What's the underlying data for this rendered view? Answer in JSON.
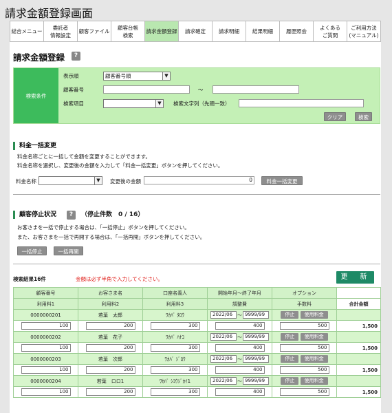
{
  "window_title": "請求金額登録画面",
  "nav": [
    {
      "label": "総合メニュー",
      "active": false
    },
    {
      "label": "委託者\n情報設定",
      "active": false
    },
    {
      "label": "顧客ファイル",
      "active": false
    },
    {
      "label": "顧客台帳\n検索",
      "active": false
    },
    {
      "label": "請求金額登録",
      "active": true
    },
    {
      "label": "請求確定",
      "active": false
    },
    {
      "label": "請求明細",
      "active": false
    },
    {
      "label": "結果明細",
      "active": false
    },
    {
      "label": "履歴照会",
      "active": false
    },
    {
      "label": "よくある\nご質問",
      "active": false
    },
    {
      "label": "ご利用方法\n(マニュアル)",
      "active": false
    }
  ],
  "page_title": "請求金額登録",
  "help_glyph": "?",
  "search": {
    "section_label": "検索条件",
    "sort_label": "表示順",
    "sort_value": "顧客番号順",
    "customer_no_label": "顧客番号",
    "range_sep": "～",
    "item_label": "検索項目",
    "text_label": "検索文字列（先頭一致）",
    "clear_button": "クリア",
    "search_button": "検索"
  },
  "bulk": {
    "title": "料金一括変更",
    "desc1": "料金名称ごとに一括して金額を変更することができます。",
    "desc2": "料金名称を選択し、変更後の金額を入力して「料金一括変更」ボタンを押してください。",
    "fee_name_label": "料金名称",
    "new_amount_label": "変更後の金額",
    "new_amount_value": "0",
    "bulk_button": "料金一括変更"
  },
  "stop": {
    "title": "顧客停止状況",
    "count_text": "（停止件数　0 / 16）",
    "desc1": "お客さまを一括で停止する場合は、「一括停止」ボタンを押してください。",
    "desc2": "また、お客さまを一括で再開する場合は、「一括再開」ボタンを押してください。",
    "stop_all_button": "一括停止",
    "resume_all_button": "一括再開"
  },
  "results": {
    "count_label": "検索結果16件",
    "notice": "金額は必ず半角で入力してください。",
    "update_button": "更　新",
    "header_top": [
      "顧客番号",
      "お客さま名",
      "口座名義人",
      "開始年月～終了年月",
      "オプション"
    ],
    "header_bottom": [
      "利用料1",
      "利用料2",
      "利用料3",
      "調整費",
      "手数料",
      "合計金額"
    ],
    "rows": [
      {
        "customer_no": "0000000201",
        "name": "若葉　太郎",
        "holder": "ﾜｶﾊﾞ ﾀﾛｳ",
        "start": "2022/06",
        "end": "9999/99",
        "stop": "停止",
        "fee_button": "使用料金",
        "f1": "100",
        "f2": "200",
        "f3": "300",
        "adj": "400",
        "commission": "500",
        "total": "1,500"
      },
      {
        "customer_no": "0000000202",
        "name": "若葉　花子",
        "holder": "ﾜｶﾊﾞ ﾊﾅｺ",
        "start": "2022/06",
        "end": "9999/99",
        "stop": "停止",
        "fee_button": "使用料金",
        "f1": "100",
        "f2": "200",
        "f3": "300",
        "adj": "400",
        "commission": "500",
        "total": "1,500"
      },
      {
        "customer_no": "0000000203",
        "name": "若葉　次郎",
        "holder": "ﾜｶﾊﾞ ｼﾞﾛｳ",
        "start": "2022/06",
        "end": "9999/99",
        "stop": "停止",
        "fee_button": "使用料金",
        "f1": "100",
        "f2": "200",
        "f3": "300",
        "adj": "400",
        "commission": "500",
        "total": "1,500"
      },
      {
        "customer_no": "0000000204",
        "name": "若葉　ロロ1",
        "holder": "ﾜｶﾊﾞ ｼﾖｳｼﾞｶｲ1",
        "start": "2022/06",
        "end": "9999/99",
        "stop": "停止",
        "fee_button": "使用料金",
        "f1": "100",
        "f2": "200",
        "f3": "300",
        "adj": "400",
        "commission": "500",
        "total": "1,500"
      }
    ]
  }
}
